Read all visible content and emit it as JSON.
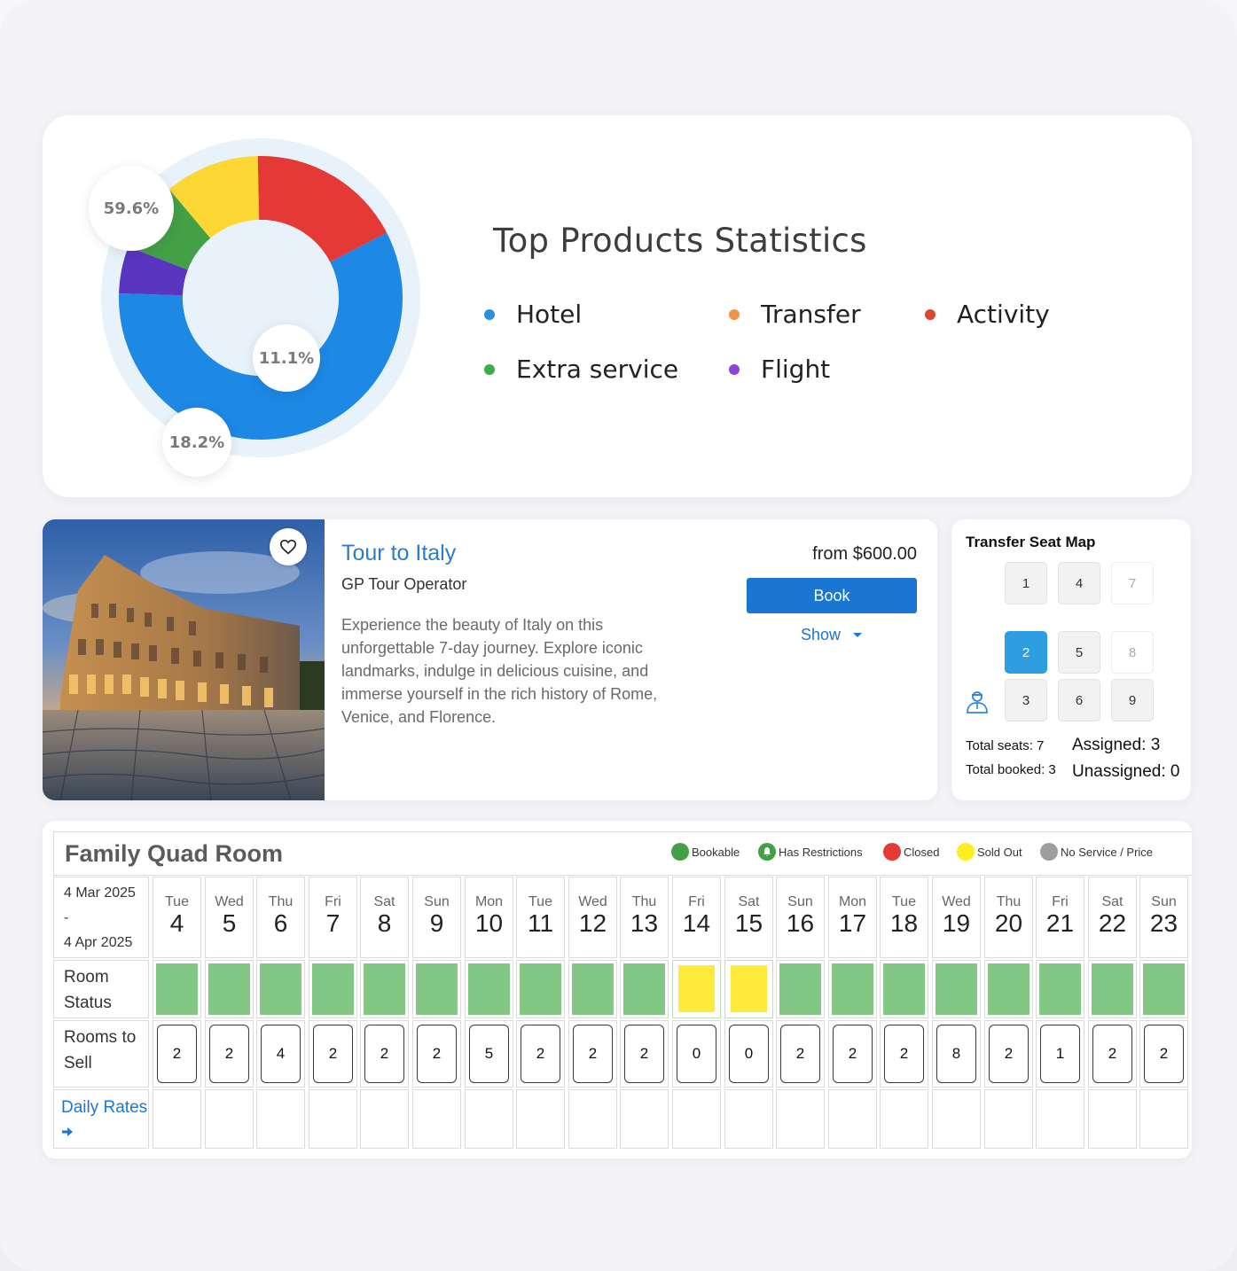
{
  "stats": {
    "title": "Top Products Statistics",
    "bubbles": [
      "59.6%",
      "11.1%",
      "18.2%"
    ],
    "legend": [
      {
        "label": "Hotel",
        "color": "#2d8fdd"
      },
      {
        "label": "Transfer",
        "color": "#f0944a"
      },
      {
        "label": "Activity",
        "color": "#e0442f"
      },
      {
        "label": "Extra service",
        "color": "#3cab4c"
      },
      {
        "label": "Flight",
        "color": "#8c45d8"
      }
    ],
    "chart_data": {
      "type": "pie",
      "style": "donut",
      "slices": [
        {
          "color": "#1e88e5",
          "value": 59.6
        },
        {
          "color": "#5a35c0",
          "value": 5.5
        },
        {
          "color": "#43a047",
          "value": 8.2
        },
        {
          "color": "#fdd835",
          "value": 11.1
        },
        {
          "color": "#e53935",
          "value": 18.2
        }
      ]
    }
  },
  "tour": {
    "title": "Tour to Italy",
    "operator": "GP Tour Operator",
    "description": "Experience the beauty of Italy on this unforgettable 7-day journey. Explore iconic landmarks, indulge in delicious cuisine, and immerse yourself in the rich history of Rome, Venice, and Florence.",
    "price": "from $600.00",
    "book_label": "Book",
    "show_label": "Show",
    "favorite_icon": "heart-icon"
  },
  "seatmap": {
    "title": "Transfer Seat Map",
    "seats": [
      {
        "label": "1",
        "state": "available"
      },
      {
        "label": "4",
        "state": "available"
      },
      {
        "label": "7",
        "state": "disabled"
      },
      {
        "label": "2",
        "state": "selected"
      },
      {
        "label": "5",
        "state": "available"
      },
      {
        "label": "8",
        "state": "disabled"
      },
      {
        "label": "3",
        "state": "available"
      },
      {
        "label": "6",
        "state": "available"
      },
      {
        "label": "9",
        "state": "available"
      }
    ],
    "total_seats": "Total seats: 7",
    "total_booked": "Total booked: 3",
    "assigned": "Assigned: 3",
    "unassigned": "Unassigned: 0"
  },
  "calendar": {
    "room_title": "Family Quad Room",
    "legend": [
      {
        "label": "Bookable",
        "color": "#43a047"
      },
      {
        "label": "Has Restrictions",
        "color": "#43a047"
      },
      {
        "label": "Closed",
        "color": "#e53935"
      },
      {
        "label": "Sold Out",
        "color": "#fdee21"
      },
      {
        "label": "No Service / Price",
        "color": "#9e9e9e"
      }
    ],
    "range_start": "4 Mar 2025",
    "range_sep": "-",
    "range_end": "4 Apr 2025",
    "room_status_label": "Room Status",
    "rooms_to_sell_label": "Rooms to Sell",
    "daily_rates_label": "Daily Rates",
    "days": [
      {
        "name": "Tue",
        "num": "4",
        "status": "bookable",
        "sell": "2"
      },
      {
        "name": "Wed",
        "num": "5",
        "status": "bookable",
        "sell": "2"
      },
      {
        "name": "Thu",
        "num": "6",
        "status": "bookable",
        "sell": "4"
      },
      {
        "name": "Fri",
        "num": "7",
        "status": "bookable",
        "sell": "2"
      },
      {
        "name": "Sat",
        "num": "8",
        "status": "bookable",
        "sell": "2"
      },
      {
        "name": "Sun",
        "num": "9",
        "status": "bookable",
        "sell": "2"
      },
      {
        "name": "Mon",
        "num": "10",
        "status": "bookable",
        "sell": "5"
      },
      {
        "name": "Tue",
        "num": "11",
        "status": "bookable",
        "sell": "2"
      },
      {
        "name": "Wed",
        "num": "12",
        "status": "bookable",
        "sell": "2"
      },
      {
        "name": "Thu",
        "num": "13",
        "status": "bookable",
        "sell": "2"
      },
      {
        "name": "Fri",
        "num": "14",
        "status": "sold-out",
        "sell": "0"
      },
      {
        "name": "Sat",
        "num": "15",
        "status": "sold-out",
        "sell": "0"
      },
      {
        "name": "Sun",
        "num": "16",
        "status": "bookable",
        "sell": "2"
      },
      {
        "name": "Mon",
        "num": "17",
        "status": "bookable",
        "sell": "2"
      },
      {
        "name": "Tue",
        "num": "18",
        "status": "bookable",
        "sell": "2"
      },
      {
        "name": "Wed",
        "num": "19",
        "status": "bookable",
        "sell": "8"
      },
      {
        "name": "Thu",
        "num": "20",
        "status": "bookable",
        "sell": "2"
      },
      {
        "name": "Fri",
        "num": "21",
        "status": "bookable",
        "sell": "1"
      },
      {
        "name": "Sat",
        "num": "22",
        "status": "bookable",
        "sell": "2"
      },
      {
        "name": "Sun",
        "num": "23",
        "status": "bookable",
        "sell": "2"
      }
    ]
  }
}
